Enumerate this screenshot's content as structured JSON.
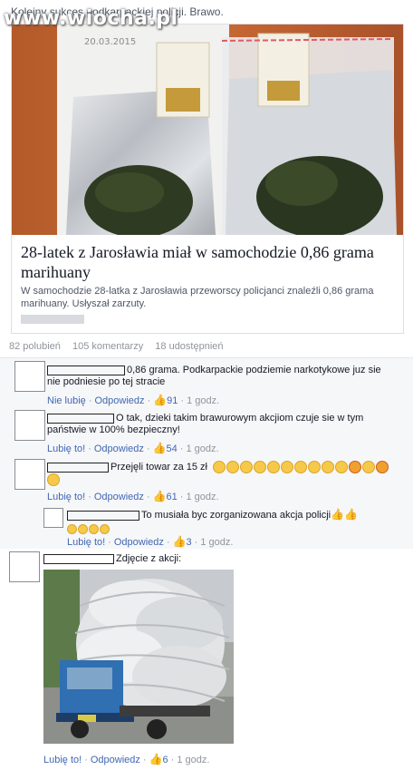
{
  "watermark": "www.wiocha.pl",
  "post": {
    "text": "Kolejny sukces podkarpackiej policji. Brawo.",
    "photo_stamp": "20.03.2015",
    "link_title": "28-latek z Jarosławia miał w samochodzie 0,86 grama marihuany",
    "link_description": "W samochodzie 28-latka z Jarosławia przeworscy policjanci znaleźli 0,86 grama marihuany. Usłyszał zarzuty.",
    "stats": {
      "likes": "82 polubień",
      "comments": "105 komentarzy",
      "shares": "18 udostępnień"
    }
  },
  "comments": [
    {
      "text": "0,86 grama. Podkarpackie podziemie narkotykowe juz sie nie podniesie po tej stracie",
      "like_action": "Nie lubię",
      "reply_action": "Odpowiedz",
      "likes": "91",
      "time": "1 godz."
    },
    {
      "text": "O tak, dzieki takim brawurowym akcjiom czuje sie w tym państwie w 100% bezpieczny!",
      "like_action": "Lubię to!",
      "reply_action": "Odpowiedz",
      "likes": "54",
      "time": "1 godz."
    },
    {
      "text": "Przejęli towar za 15 zł",
      "like_action": "Lubię to!",
      "reply_action": "Odpowiedz",
      "likes": "61",
      "time": "1 godz."
    },
    {
      "text": "To musiała byc zorganizowana akcja policji",
      "like_action": "Lubię to!",
      "reply_action": "Odpowiedz",
      "likes": "3",
      "time": "1 godz."
    },
    {
      "text": "Zdjęcie z akcji:",
      "like_action": "Lubię to!",
      "reply_action": "Odpowiedz",
      "likes": "6",
      "time": "1 godz."
    }
  ]
}
